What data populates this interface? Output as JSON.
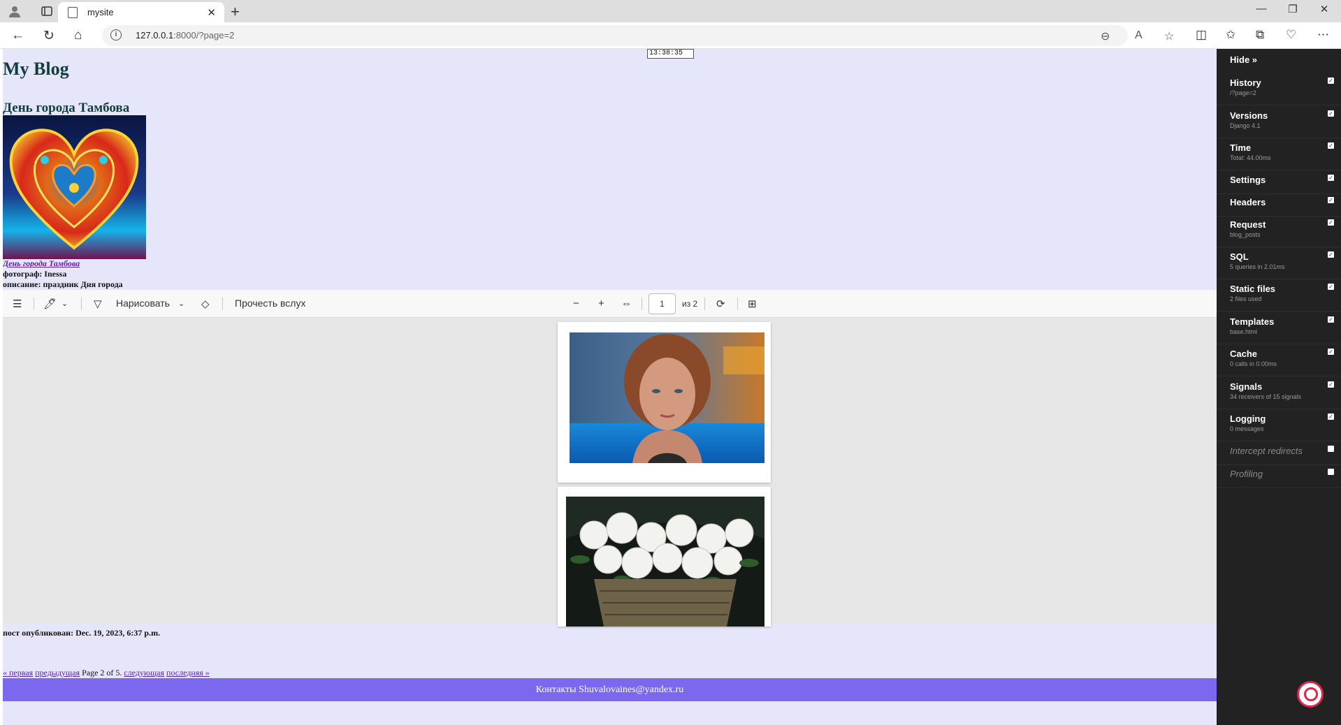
{
  "browser": {
    "tab_title": "mysite",
    "url_host": "127.0.0.1",
    "url_rest": ":8000/?page=2",
    "icons": [
      "profile-icon",
      "tabs-icon",
      "back-icon",
      "refresh-icon",
      "home-icon",
      "info-icon",
      "zoom-out-icon",
      "read-aloud-icon",
      "favorite-icon",
      "split-icon",
      "favorites-icon",
      "collections-icon",
      "extensions-icon",
      "more-icon"
    ]
  },
  "page": {
    "clock": "13:38:35",
    "site_title": "My Blog",
    "post_title": "День города Тамбова",
    "post_link": "День города Тамбова",
    "photographer": "фотограф: Inessa",
    "description": "описание: праздник Дня города",
    "published": "пост опубликован: Dec. 19, 2023, 6:37 p.m.",
    "pager": {
      "first": "« первая",
      "prev": "предыдущая",
      "status": "Page 2 of 5.",
      "next": "следующая",
      "last": "последняя »"
    },
    "footer": "Контакты Shuvalovaines@yandex.ru"
  },
  "pdf": {
    "draw_label": "Нарисовать",
    "read_aloud_label": "Прочесть вслух",
    "page_value": "1",
    "page_total": "из 2"
  },
  "debug_toolbar": {
    "hide_label": "Hide »",
    "panels": [
      {
        "title": "History",
        "sub": "/?page=2",
        "checked": true
      },
      {
        "title": "Versions",
        "sub": "Django 4.1",
        "checked": true
      },
      {
        "title": "Time",
        "sub": "Total: 44.00ms",
        "checked": true
      },
      {
        "title": "Settings",
        "sub": "",
        "checked": true
      },
      {
        "title": "Headers",
        "sub": "",
        "checked": true
      },
      {
        "title": "Request",
        "sub": "blog_posts",
        "checked": true
      },
      {
        "title": "SQL",
        "sub": "5 queries in 2.01ms",
        "checked": true
      },
      {
        "title": "Static files",
        "sub": "2 files used",
        "checked": true
      },
      {
        "title": "Templates",
        "sub": "base.html",
        "checked": true
      },
      {
        "title": "Cache",
        "sub": "0 calls in 0.00ms",
        "checked": true
      },
      {
        "title": "Signals",
        "sub": "34 receivers of 15 signals",
        "checked": true
      },
      {
        "title": "Logging",
        "sub": "0 messages",
        "checked": true
      },
      {
        "title": "Intercept redirects",
        "sub": "",
        "checked": false
      },
      {
        "title": "Profiling",
        "sub": "",
        "checked": false
      }
    ]
  },
  "colors": {
    "page_bg": "#e6e6fa",
    "footer_bg": "#7b68ee",
    "debug_bg": "#222222",
    "link": "#5a1ea8"
  }
}
